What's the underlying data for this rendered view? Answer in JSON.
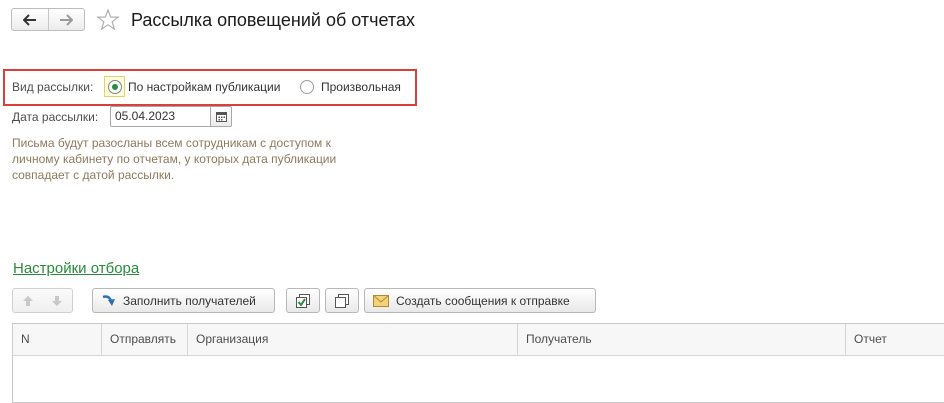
{
  "header": {
    "back_icon": "arrow-left-icon",
    "forward_icon": "arrow-right-icon",
    "favorite_icon": "star-icon",
    "title": "Рассылка оповещений об отчетах"
  },
  "form": {
    "delivery_type_label": "Вид рассылки:",
    "delivery_options": [
      {
        "label": "По настройкам публикации",
        "selected": true
      },
      {
        "label": "Произвольная",
        "selected": false
      }
    ],
    "date_label": "Дата рассылки:",
    "date_value": "05.04.2023",
    "calendar_icon": "calendar-icon",
    "note_lines": [
      "Письма будут разосланы всем сотрудникам с доступом к",
      "личному кабинету по отчетам, у которых дата публикации",
      "совпадает с датой рассылки."
    ],
    "filter_link": "Настройки отбора"
  },
  "toolbar": {
    "move_up_icon": "arrow-up-icon",
    "move_down_icon": "arrow-down-icon",
    "fill_recipients_label": "Заполнить получателей",
    "fill_recipients_icon": "curved-arrow-icon",
    "check_all_icon": "check-all-icon",
    "uncheck_all_icon": "uncheck-all-icon",
    "create_messages_label": "Создать сообщения к отправке",
    "create_messages_icon": "envelope-icon"
  },
  "table": {
    "columns": [
      "N",
      "Отправлять",
      "Организация",
      "Получатель",
      "Отчет"
    ],
    "rows": []
  },
  "colors": {
    "highlight": "#d9403a",
    "link": "#2a8a3c",
    "note_text": "#8e7a5c",
    "radio_selected": "#2e8b3e"
  }
}
